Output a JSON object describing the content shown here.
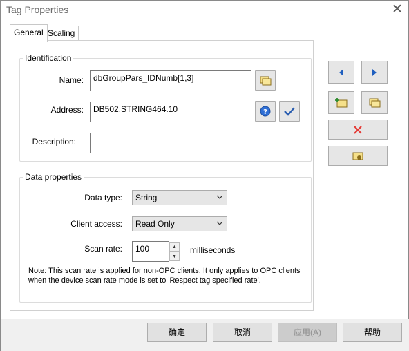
{
  "window": {
    "title": "Tag Properties",
    "close_symbol": "✕"
  },
  "tabs": [
    {
      "label": "General",
      "active": true
    },
    {
      "label": "Scaling",
      "active": false
    }
  ],
  "identification": {
    "legend": "Identification",
    "name_label": "Name:",
    "name_value": "dbGroupPars_IDNumb[1,3]",
    "address_label": "Address:",
    "address_value": "DB502.STRING464.10",
    "description_label": "Description:",
    "description_value": ""
  },
  "data_properties": {
    "legend": "Data properties",
    "data_type_label": "Data type:",
    "data_type_value": "String",
    "client_access_label": "Client access:",
    "client_access_value": "Read Only",
    "scan_rate_label": "Scan rate:",
    "scan_rate_value": "100",
    "scan_rate_unit": "milliseconds",
    "note_line1": "Note: This scan rate is applied for non-OPC clients. It only applies to OPC clients",
    "note_line2": "when the device scan rate mode is set to 'Respect tag specified rate'."
  },
  "buttons": {
    "ok": "确定",
    "cancel": "取消",
    "apply": "应用(A)",
    "help": "帮助"
  },
  "colors": {
    "nav_arrow": "#1f5fbf",
    "delete_x": "#e53935",
    "help_icon": "#2f6fd6",
    "checkmark": "#2a5db0",
    "tag_icon_fill": "#f5e08a",
    "tag_icon_stroke": "#8a6d1c"
  }
}
